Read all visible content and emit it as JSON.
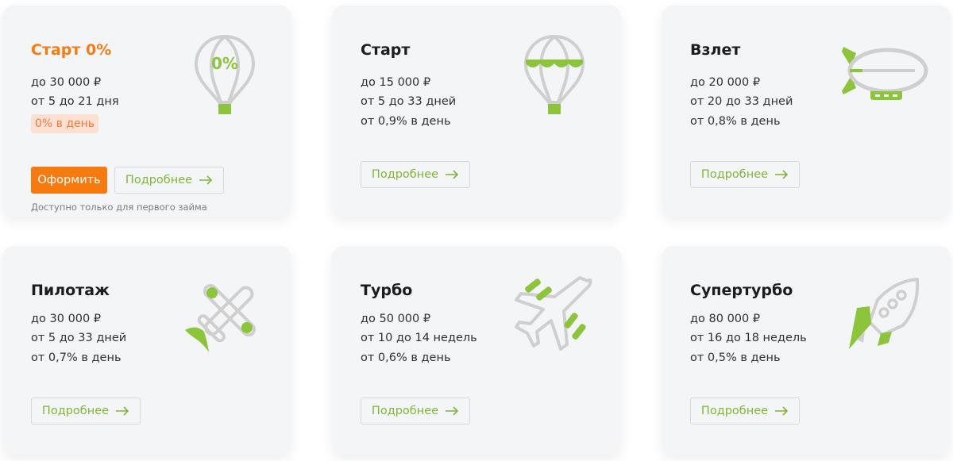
{
  "colors": {
    "card_bg": "#f4f5f7",
    "accent_orange": "#f57a0f",
    "accent_green": "#7fb636",
    "icon_gray": "#cfcfcf",
    "badge_bg": "#fce0d2",
    "badge_text": "#ef7a3c"
  },
  "more_label": "Подробнее",
  "cards": [
    {
      "title": "Старт 0%",
      "amount": "до 30 000 ₽",
      "term": "от 5 до 21 дня",
      "badge": "0% в день",
      "apply_label": "Оформить",
      "note": "Доступно только для первого займа",
      "icon": "balloon-zero-percent-icon",
      "icon_text": "0%"
    },
    {
      "title": "Старт",
      "amount": "до 15 000 ₽",
      "term": "от 5 до 33 дней",
      "rate": "от 0,9% в день",
      "icon": "hot-air-balloon-icon"
    },
    {
      "title": "Взлет",
      "amount": "до 20 000 ₽",
      "term": "от 20 до 33 дней",
      "rate": "от 0,8% в день",
      "icon": "airship-icon"
    },
    {
      "title": "Пилотаж",
      "amount": "до 30 000 ₽",
      "term": "от 5 до 33 дней",
      "rate": "от 0,7% в день",
      "icon": "propeller-plane-icon"
    },
    {
      "title": "Турбо",
      "amount": "до 50 000 ₽",
      "term": "от 10 до 14 недель",
      "rate": "от 0,6% в день",
      "icon": "jet-plane-icon"
    },
    {
      "title": "Супертурбо",
      "amount": "до 80 000 ₽",
      "term": "от 16 до 18 недель",
      "rate": "от 0,5% в день",
      "icon": "rocket-icon"
    }
  ]
}
